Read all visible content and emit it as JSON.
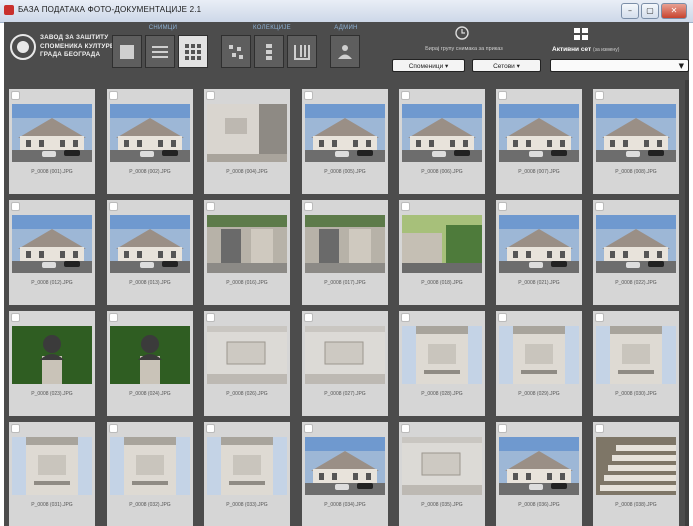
{
  "window": {
    "title": "БАЗА ПОДАТАКА ФОТО-ДОКУМЕНТАЦИЈЕ 2.1",
    "controls": [
      "–",
      "▢",
      "✕"
    ]
  },
  "brand": {
    "lines": [
      "ЗАВОД ЗА ЗАШТИТУ",
      "СПОМЕНИКА КУЛТУРЕ",
      "ГРАДА БЕОГРАДА"
    ]
  },
  "toolbar": {
    "groups": [
      {
        "label": "СНИМЦИ",
        "buttons": [
          "large-thumbs",
          "list-view",
          "grid-view"
        ],
        "active": 2
      },
      {
        "label": "КОЛЕКЦИЈЕ",
        "buttons": [
          "scatter-view",
          "column-view",
          "tile-view"
        ],
        "active": -1
      },
      {
        "label": "АДМИН",
        "buttons": [
          "admin-user"
        ],
        "active": -1
      }
    ],
    "hint": "Бирај групу снимака за приказ",
    "monuments_label": "Споменици ▾",
    "sets_label": "Сетови ▾",
    "active_set_title": "Активни сет",
    "active_set_hint": "(за измену)",
    "active_set_value": ""
  },
  "gallery": {
    "items": [
      {
        "file": "P_0008 (001).JPG",
        "scene": "house"
      },
      {
        "file": "P_0008 (002).JPG",
        "scene": "house"
      },
      {
        "file": "P_0008 (004).JPG",
        "scene": "wall"
      },
      {
        "file": "P_0008 (005).JPG",
        "scene": "house"
      },
      {
        "file": "P_0008 (006).JPG",
        "scene": "house"
      },
      {
        "file": "P_0008 (007).JPG",
        "scene": "house"
      },
      {
        "file": "P_0008 (008).JPG",
        "scene": "house"
      },
      {
        "file": "P_0008 (012).JPG",
        "scene": "house"
      },
      {
        "file": "P_0008 (013).JPG",
        "scene": "house"
      },
      {
        "file": "P_0008 (016).JPG",
        "scene": "gate"
      },
      {
        "file": "P_0008 (017).JPG",
        "scene": "gate"
      },
      {
        "file": "P_0008 (018).JPG",
        "scene": "street"
      },
      {
        "file": "P_0008 (021).JPG",
        "scene": "house"
      },
      {
        "file": "P_0008 (022).JPG",
        "scene": "house"
      },
      {
        "file": "P_0008 (023).JPG",
        "scene": "bust"
      },
      {
        "file": "P_0008 (024).JPG",
        "scene": "bust"
      },
      {
        "file": "P_0008 (026).JPG",
        "scene": "plaque"
      },
      {
        "file": "P_0008 (027).JPG",
        "scene": "plaque"
      },
      {
        "file": "P_0008 (028).JPG",
        "scene": "detail"
      },
      {
        "file": "P_0008 (029).JPG",
        "scene": "detail"
      },
      {
        "file": "P_0008 (030).JPG",
        "scene": "detail"
      },
      {
        "file": "P_0008 (031).JPG",
        "scene": "detail"
      },
      {
        "file": "P_0008 (032).JPG",
        "scene": "detail"
      },
      {
        "file": "P_0008 (033).JPG",
        "scene": "detail"
      },
      {
        "file": "P_0008 (034).JPG",
        "scene": "house"
      },
      {
        "file": "P_0008 (035).JPG",
        "scene": "plaque"
      },
      {
        "file": "P_0008 (036).JPG",
        "scene": "house"
      },
      {
        "file": "P_0008 (038).JPG",
        "scene": "stairs"
      }
    ]
  }
}
